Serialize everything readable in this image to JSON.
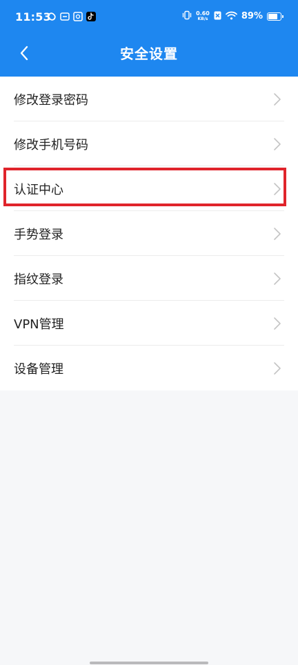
{
  "status_bar": {
    "time": "11:53",
    "notification_icons": [
      "sync-icon",
      "wallet-icon",
      "album-icon",
      "tiktok-icon"
    ],
    "net_speed_value": "0.60",
    "net_speed_unit": "KB/s",
    "battery_percent_text": "89%",
    "battery_level": 0.89
  },
  "header": {
    "title": "安全设置",
    "back_icon": "chevron-left-icon",
    "background_color": "#1e87f0"
  },
  "menu": {
    "items": [
      {
        "label": "修改登录密码",
        "icon": "chevron-right-icon"
      },
      {
        "label": "修改手机号码",
        "icon": "chevron-right-icon"
      },
      {
        "label": "认证中心",
        "icon": "chevron-right-icon",
        "highlighted": true,
        "highlight_color": "#e0242b"
      },
      {
        "label": "手势登录",
        "icon": "chevron-right-icon"
      },
      {
        "label": "指纹登录",
        "icon": "chevron-right-icon"
      },
      {
        "label": "VPN管理",
        "icon": "chevron-right-icon"
      },
      {
        "label": "设备管理",
        "icon": "chevron-right-icon"
      }
    ]
  }
}
